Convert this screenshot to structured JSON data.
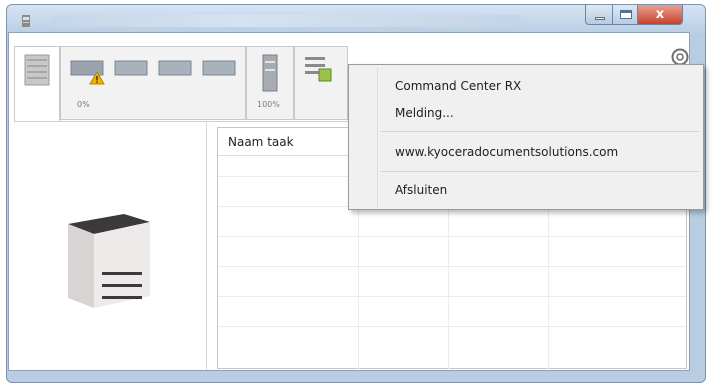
{
  "window": {
    "title": "",
    "close_glyph": "x"
  },
  "status_tabs": [
    {
      "name": "tab-device-status",
      "label": ""
    },
    {
      "name": "tab-input-trays",
      "label": "0%"
    },
    {
      "name": "tab-output-trays",
      "label": "100%"
    },
    {
      "name": "tab-job-list",
      "label": ""
    }
  ],
  "job_table": {
    "columns": [
      "Naam taak"
    ]
  },
  "context_menu": {
    "items": [
      "Command Center RX",
      "Melding...",
      "www.kyoceradocumentsolutions.com",
      "Afsluiten"
    ]
  },
  "colors": {
    "titlebar": "#c7d8ea",
    "close_button": "#d2513a",
    "warning_icon": "#f2b300",
    "menu_background": "#f0f0f0"
  },
  "icons": [
    "printer-app-icon",
    "settings-gear-icon",
    "warning-icon",
    "printer-device-icon",
    "paper-tray-icon",
    "output-tray-icon",
    "job-list-icon"
  ]
}
